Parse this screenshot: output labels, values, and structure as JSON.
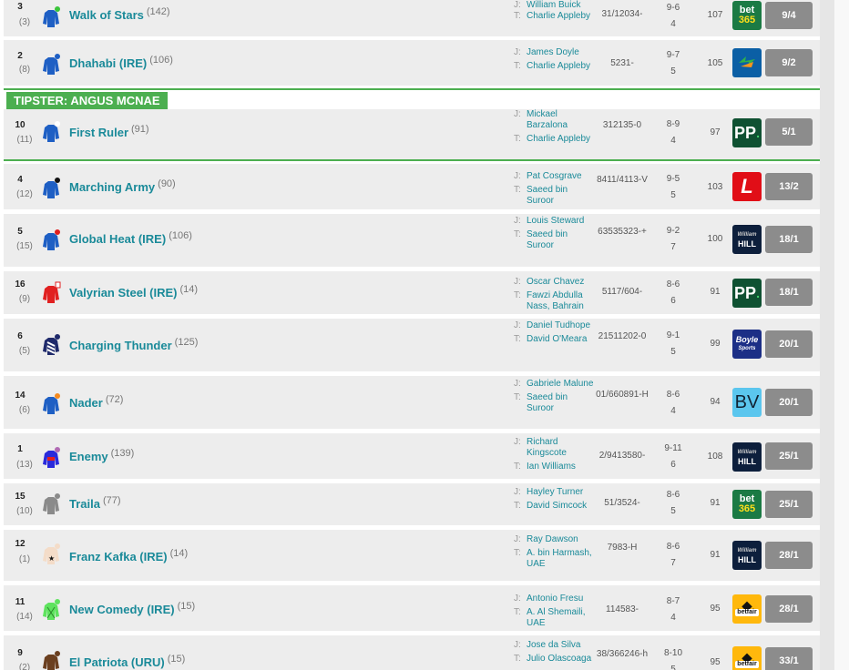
{
  "tipster_label": "TIPSTER: ANGUS MCNAE",
  "labels": {
    "jockey": "J:",
    "trainer": "T:"
  },
  "runners": [
    {
      "number": "3",
      "draw": "(3)",
      "name": "Walk of Stars",
      "rating": "(142)",
      "jockey": "William Buick",
      "trainer": "Charlie Appleby",
      "form": "31/12034-",
      "age": "9-6",
      "weight": "4",
      "or": "107",
      "bookmaker": "bet365",
      "odds": "9/4"
    },
    {
      "number": "2",
      "draw": "(8)",
      "name": "Dhahabi (IRE)",
      "rating": "(106)",
      "jockey": "James Doyle",
      "trainer": "Charlie Appleby",
      "form": "5231-",
      "age": "9-7",
      "weight": "5",
      "or": "105",
      "bookmaker": "paddypower",
      "odds": "9/2"
    },
    {
      "number": "10",
      "draw": "(11)",
      "name": "First Ruler",
      "rating": "(91)",
      "jockey": "Mickael Barzalona",
      "trainer": "Charlie Appleby",
      "form": "312135-0",
      "age": "8-9",
      "weight": "4",
      "or": "97",
      "bookmaker": "PP",
      "odds": "5/1"
    },
    {
      "number": "4",
      "draw": "(12)",
      "name": "Marching Army",
      "rating": "(90)",
      "jockey": "Pat Cosgrave",
      "trainer": "Saeed bin Suroor",
      "form": "8411/4113-V",
      "age": "9-5",
      "weight": "5",
      "or": "103",
      "bookmaker": "ladbrokes",
      "odds": "13/2"
    },
    {
      "number": "5",
      "draw": "(15)",
      "name": "Global Heat (IRE)",
      "rating": "(106)",
      "jockey": "Louis Steward",
      "trainer": "Saeed bin Suroor",
      "form": "63535323-+",
      "age": "9-2",
      "weight": "7",
      "or": "100",
      "bookmaker": "williamhill",
      "odds": "18/1"
    },
    {
      "number": "16",
      "draw": "(9)",
      "name": "Valyrian Steel (IRE)",
      "rating": "(14)",
      "jockey": "Oscar Chavez",
      "trainer": "Fawzi Abdulla Nass, Bahrain",
      "form": "5117/604-",
      "age": "8-6",
      "weight": "6",
      "or": "91",
      "bookmaker": "PP",
      "odds": "18/1"
    },
    {
      "number": "6",
      "draw": "(5)",
      "name": "Charging Thunder",
      "rating": "(125)",
      "jockey": "Daniel Tudhope",
      "trainer": "David O'Meara",
      "form": "21511202-0",
      "age": "9-1",
      "weight": "5",
      "or": "99",
      "bookmaker": "boylesports",
      "odds": "20/1"
    },
    {
      "number": "14",
      "draw": "(6)",
      "name": "Nader",
      "rating": "(72)",
      "jockey": "Gabriele Malune",
      "trainer": "Saeed bin Suroor",
      "form": "01/660891-H",
      "age": "8-6",
      "weight": "4",
      "or": "94",
      "bookmaker": "BV",
      "odds": "20/1"
    },
    {
      "number": "1",
      "draw": "(13)",
      "name": "Enemy",
      "rating": "(139)",
      "jockey": "Richard Kingscote",
      "trainer": "Ian Williams",
      "form": "2/9413580-",
      "age": "9-11",
      "weight": "6",
      "or": "108",
      "bookmaker": "williamhill",
      "odds": "25/1"
    },
    {
      "number": "15",
      "draw": "(10)",
      "name": "Traila",
      "rating": "(77)",
      "jockey": "Hayley Turner",
      "trainer": "David Simcock",
      "form": "51/3524-",
      "age": "8-6",
      "weight": "5",
      "or": "91",
      "bookmaker": "bet365",
      "odds": "25/1"
    },
    {
      "number": "12",
      "draw": "(1)",
      "name": "Franz Kafka (IRE)",
      "rating": "(14)",
      "jockey": "Ray Dawson",
      "trainer": "A. bin Harmash, UAE",
      "form": "7983-H",
      "age": "8-6",
      "weight": "7",
      "or": "91",
      "bookmaker": "williamhill",
      "odds": "28/1"
    },
    {
      "number": "11",
      "draw": "(14)",
      "name": "New Comedy (IRE)",
      "rating": "(15)",
      "jockey": "Antonio Fresu",
      "trainer": "A. Al Shemaili, UAE",
      "form": "114583-",
      "age": "8-7",
      "weight": "4",
      "or": "95",
      "bookmaker": "betfair",
      "odds": "28/1"
    },
    {
      "number": "9",
      "draw": "(2)",
      "name": "El Patriota (URU)",
      "rating": "(15)",
      "jockey": "Jose da Silva",
      "trainer": "Julio Olascoaga",
      "form": "38/366246-h",
      "age": "8-10",
      "weight": "5",
      "or": "95",
      "bookmaker": "betfair",
      "odds": "33/1"
    }
  ],
  "bookmaker_text": {
    "bet365_top": "bet",
    "bet365_bottom": "365",
    "pp": "PP",
    "ladbrokes": "L",
    "wh_top": "William",
    "wh_bottom": "HILL",
    "boyle_top": "Boyle",
    "boyle_bottom": "Sports",
    "bv": "BV",
    "betfair": "betfair"
  },
  "colors": {
    "accent": "#1a8a99",
    "tipster_green": "#4caf50",
    "odds_grey": "#8c8c8c"
  }
}
